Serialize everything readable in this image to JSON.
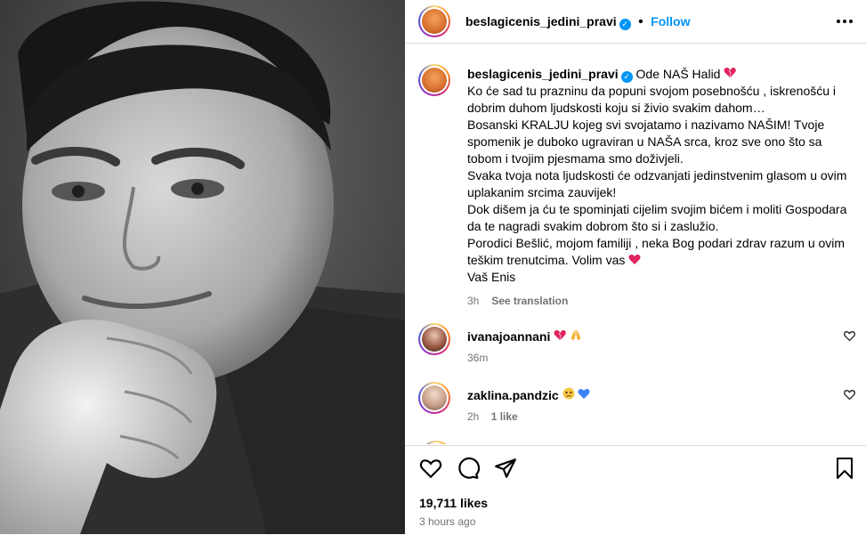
{
  "post": {
    "username": "beslagicenis_jedini_pravi",
    "follow_separator": "•",
    "follow_label": "Follow",
    "more_label": "•••"
  },
  "caption": {
    "username": "beslagicenis_jedini_pravi",
    "first_line": "Ode NAŠ Halid",
    "lines": [
      "Ko će sad tu prazninu da popuni svojom posebnošću , iskrenošću i dobrim duhom ljudskosti koju si živio svakim dahom…",
      "Bosanski KRALJU kojeg svi svojatamo i nazivamo NAŠIM! Tvoje spomenik je duboko ugraviran u NAŠA srca, kroz sve ono što sa tobom i tvojim pjesmama smo doživjeli.",
      "Svaka tvoja nota ljudskosti će odzvanjati jedinstvenim glasom u ovim uplakanim srcima zauvijek!",
      "Dok dišem ja ću te spominjati cijelim svojim bićem i moliti Gospodara da te nagradi svakim dobrom što si i zaslužio.",
      "Porodici Bešlić, mojom familiji , neka Bog podari zdrav razum u ovim teškim trenutcima. Volim vas",
      "Vaš Enis"
    ],
    "time": "3h",
    "see_translation": "See translation"
  },
  "comments": [
    {
      "username": "ivanajoannani",
      "text": "",
      "time": "36m",
      "likes": ""
    },
    {
      "username": "zaklina.pandzic",
      "text": "",
      "time": "2h",
      "likes": "1 like"
    }
  ],
  "footer": {
    "likes": "19,711 likes",
    "time": "3 hours ago"
  },
  "colors": {
    "accent": "#0095f6",
    "heart": "#e0245e",
    "muted": "#737373",
    "border": "#dbdbdb"
  },
  "icons": [
    "more-icon",
    "verified-icon",
    "heart-icon",
    "comment-icon",
    "share-icon",
    "save-icon"
  ]
}
